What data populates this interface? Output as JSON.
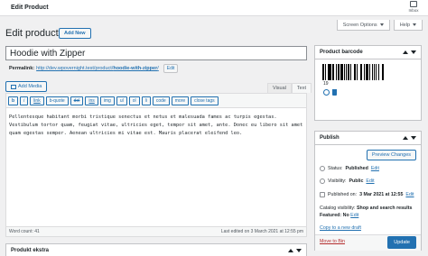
{
  "topbar": {
    "title": "Edit Product",
    "inbox_label": "Inbox"
  },
  "screen_options": {
    "screen_label": "Screen Options",
    "help_label": "Help"
  },
  "page": {
    "heading": "Edit product",
    "add_new": "Add New"
  },
  "post": {
    "title": "Hoodie with Zipper",
    "permalink_label": "Permalink:",
    "permalink_base": "http://dev.wpovernight.test/product/",
    "permalink_slug": "hoodie-with-zipper",
    "permalink_end": "/",
    "edit_label": "Edit"
  },
  "editor": {
    "add_media": "Add Media",
    "tab_visual": "Visual",
    "tab_text": "Text",
    "toolbar": [
      "b",
      "i",
      "link",
      "b-quote",
      "del",
      "ins",
      "img",
      "ul",
      "ol",
      "li",
      "code",
      "more",
      "close tags"
    ],
    "content": "Pellentesque habitant morbi tristique senectus et netus et malesuada fames ac turpis egestas. Vestibulum tortor quam, feugiat vitae, ultricies eget, tempor sit amet, ante. Donec eu libero sit amet quam egestas semper. Aenean ultricies mi vitae est. Mauris placerat eleifend leo.",
    "word_count": "Word count: 41",
    "last_edited": "Last edited on 3 March 2021 at 12:55 pm"
  },
  "next_box": {
    "title": "Produkt ekstra"
  },
  "barcode_box": {
    "title": "Product barcode",
    "number": "19",
    "bars": [
      2,
      1,
      1,
      2,
      3,
      1,
      1,
      1,
      2,
      2,
      1,
      1,
      2,
      1,
      3,
      1,
      1,
      2,
      1,
      1,
      2,
      1,
      1,
      3,
      2,
      1,
      1,
      2,
      1,
      1,
      2,
      2,
      1,
      1,
      3,
      1,
      1,
      2,
      1,
      1,
      2,
      1,
      1,
      2,
      1,
      3,
      2
    ]
  },
  "publish_box": {
    "title": "Publish",
    "preview": "Preview Changes",
    "status_label": "Status:",
    "status_value": "Published",
    "visibility_label": "Visibility:",
    "visibility_value": "Public",
    "published_label": "Published on:",
    "published_value": "3 Mar 2021 at 12:55",
    "catalog_label": "Catalog visibility:",
    "catalog_value": "Shop and search results",
    "featured_label": "Featured:",
    "featured_value": "No",
    "edit": "Edit",
    "copy_draft": "Copy to a new draft",
    "move_bin": "Move to Bin",
    "update": "Update"
  },
  "colors": {
    "accent": "#2271b1",
    "danger": "#b32d2e",
    "background": "#f0f0f1"
  }
}
